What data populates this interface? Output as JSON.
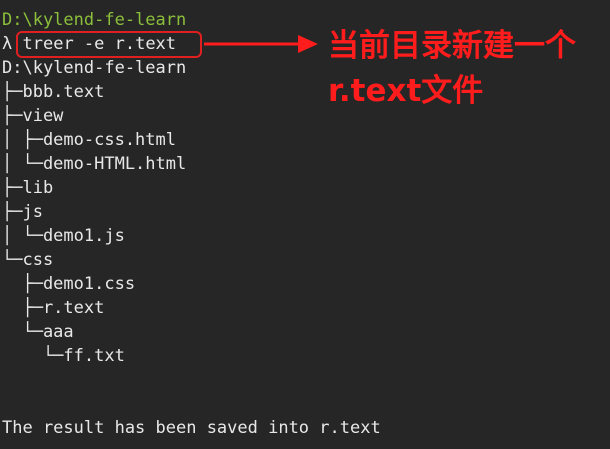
{
  "terminal": {
    "prompt_path": "D:\\kylend-fe-learn",
    "prompt_symbol": "λ",
    "command": "treer -e r.text",
    "tree": [
      {
        "name": "tree-root",
        "text": "D:\\kylend-fe-learn"
      },
      {
        "name": "tree-item-bbb-text",
        "text": "├─bbb.text"
      },
      {
        "name": "tree-item-view",
        "text": "├─view"
      },
      {
        "name": "tree-item-demo-css-html",
        "text": "│ ├─demo-css.html"
      },
      {
        "name": "tree-item-demo-html-html",
        "text": "│ └─demo-HTML.html"
      },
      {
        "name": "tree-item-lib",
        "text": "├─lib"
      },
      {
        "name": "tree-item-js",
        "text": "├─js"
      },
      {
        "name": "tree-item-demo1-js",
        "text": "│ └─demo1.js"
      },
      {
        "name": "tree-item-css",
        "text": "└─css"
      },
      {
        "name": "tree-item-demo1-css",
        "text": "  ├─demo1.css"
      },
      {
        "name": "tree-item-r-text",
        "text": "  ├─r.text"
      },
      {
        "name": "tree-item-aaa",
        "text": "  └─aaa"
      },
      {
        "name": "tree-item-ff-txt",
        "text": "    └─ff.txt"
      }
    ],
    "result_message": "The result has been saved into r.text"
  },
  "annotation": {
    "text": "当前目录新建一个r.text文件",
    "color": "#ff1c1c"
  },
  "colors": {
    "background": "#262626",
    "prompt_path": "#8cbf3b",
    "text": "#e8e8e8",
    "highlight_border": "#e02020"
  }
}
